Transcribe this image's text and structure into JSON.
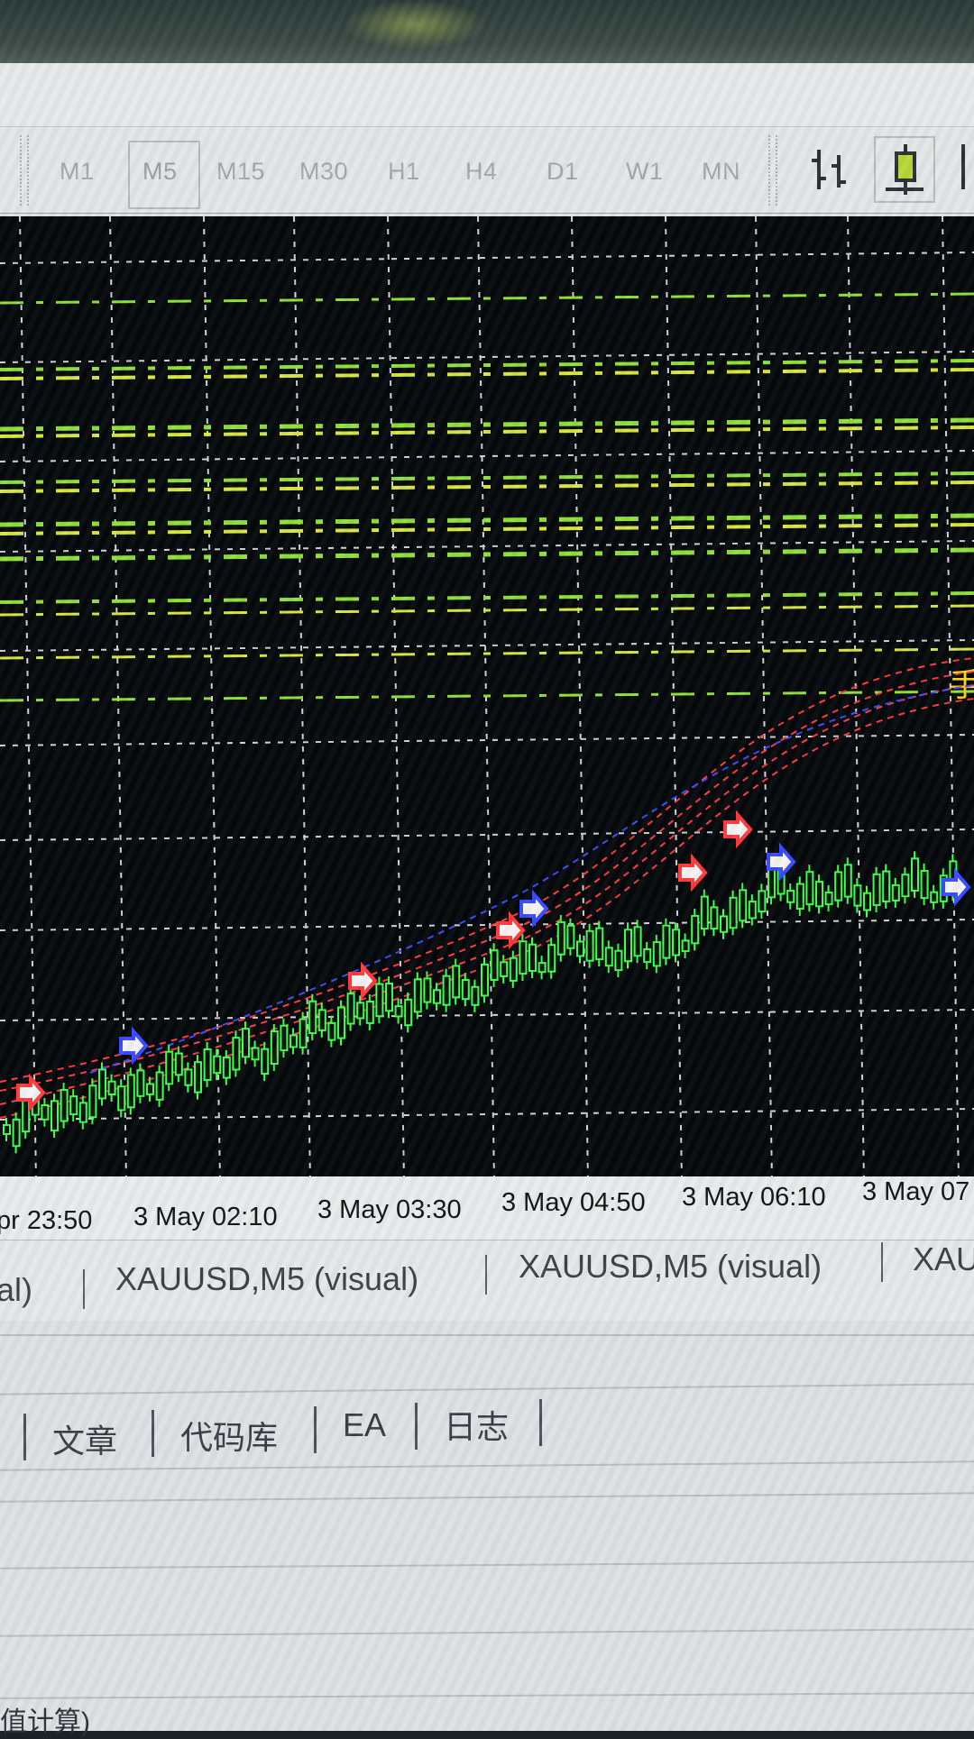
{
  "toolbar": {
    "timeframes": [
      "M1",
      "M5",
      "M15",
      "M30",
      "H1",
      "H4",
      "D1",
      "W1",
      "MN"
    ],
    "selected": "M5"
  },
  "chart": {
    "time_labels": [
      "pr 23:50",
      "3 May 02:10",
      "3 May 03:30",
      "3 May 04:50",
      "3 May 06:10",
      "3 May 07"
    ],
    "right_glyph": "手"
  },
  "window_tabs": [
    "al)",
    "XAUUSD,M5 (visual)",
    "XAUUSD,M5 (visual)",
    "XAU"
  ],
  "terminal_tabs": [
    "文章",
    "代码库",
    "EA",
    "日志"
  ],
  "bottom_text": "值计算)",
  "colors": {
    "chart_bg": "#06090b",
    "grid": "#cfd3d6",
    "level_green": "#8fe03a",
    "level_yellow": "#d8e640",
    "bull_candle": "#3cff4a",
    "ma_red": "#ff3b3b",
    "ma_blue": "#3a4bff",
    "label_yellow": "#ffd21a"
  }
}
